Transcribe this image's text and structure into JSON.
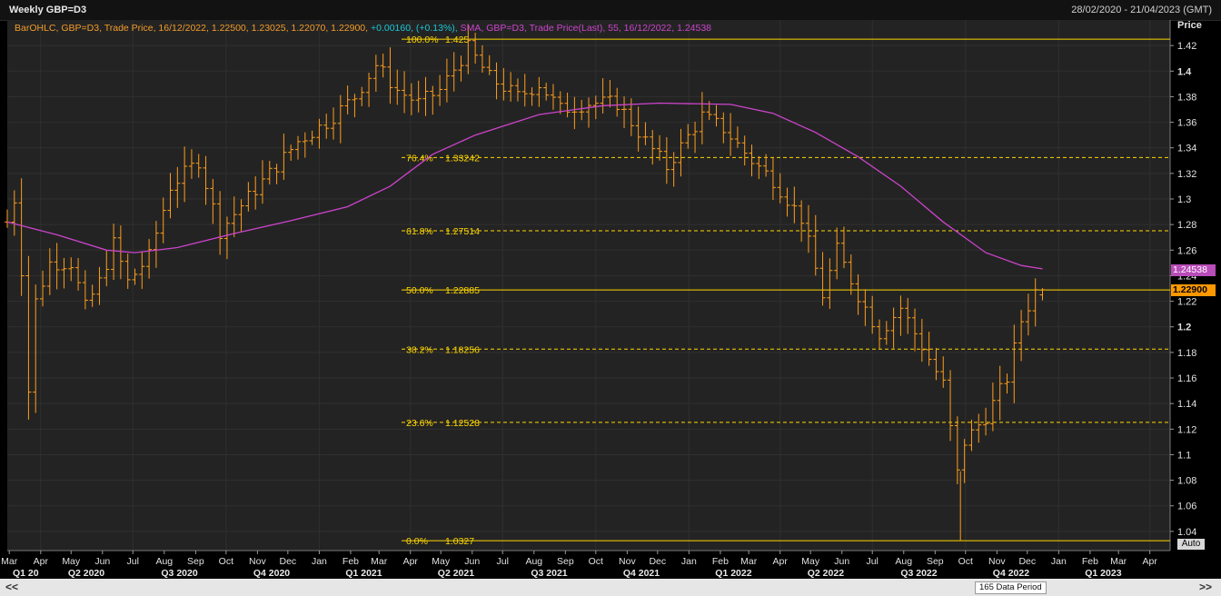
{
  "header": {
    "title": "Weekly GBP=D3",
    "date_range": "28/02/2020 - 21/04/2023 (GMT)"
  },
  "info_line": {
    "ohlc_prefix": "BarOHLC, GBP=D3, Trade Price, 16/12/2022, 1.22500, 1.23025, 1.22070, 1.22900,",
    "change": "+0.00160, (+0.13%),",
    "sma": "SMA, GBP=D3, Trade Price(Last), 55, 16/12/2022, 1.24538"
  },
  "price_axis": {
    "title": "Price",
    "sma_tag": "1.24538",
    "last_tag": "1.22900",
    "auto_button": "Auto"
  },
  "footer": {
    "data_period": "165 Data Period",
    "nav_left": "<<",
    "nav_right": ">>"
  },
  "colors": {
    "ohlc": "#ff9e1b",
    "sma": "#cc44cc",
    "fib": "#ffd700",
    "background": "#232323"
  },
  "chart_data": {
    "type": "line",
    "series_types": {
      "GBP=D3": "ohlc_bar",
      "SMA 55": "line"
    },
    "ylim": [
      1.025,
      1.44
    ],
    "y_ticks": [
      1.04,
      1.06,
      1.08,
      1.1,
      1.12,
      1.14,
      1.16,
      1.18,
      1.2,
      1.22,
      1.24,
      1.26,
      1.28,
      1.3,
      1.32,
      1.34,
      1.36,
      1.38,
      1.4,
      1.42
    ],
    "x_range": [
      "2020-02-28",
      "2023-04-21"
    ],
    "month_ticks": [
      {
        "label": "Mar",
        "date": "2020-03-01"
      },
      {
        "label": "Apr",
        "date": "2020-04-01"
      },
      {
        "label": "May",
        "date": "2020-05-01"
      },
      {
        "label": "Jun",
        "date": "2020-06-01"
      },
      {
        "label": "Jul",
        "date": "2020-07-01"
      },
      {
        "label": "Aug",
        "date": "2020-08-01"
      },
      {
        "label": "Sep",
        "date": "2020-09-01"
      },
      {
        "label": "Oct",
        "date": "2020-10-01"
      },
      {
        "label": "Nov",
        "date": "2020-11-01"
      },
      {
        "label": "Dec",
        "date": "2020-12-01"
      },
      {
        "label": "Jan",
        "date": "2021-01-01"
      },
      {
        "label": "Feb",
        "date": "2021-02-01"
      },
      {
        "label": "Mar",
        "date": "2021-03-01"
      },
      {
        "label": "Apr",
        "date": "2021-04-01"
      },
      {
        "label": "May",
        "date": "2021-05-01"
      },
      {
        "label": "Jun",
        "date": "2021-06-01"
      },
      {
        "label": "Jul",
        "date": "2021-07-01"
      },
      {
        "label": "Aug",
        "date": "2021-08-01"
      },
      {
        "label": "Sep",
        "date": "2021-09-01"
      },
      {
        "label": "Oct",
        "date": "2021-10-01"
      },
      {
        "label": "Nov",
        "date": "2021-11-01"
      },
      {
        "label": "Dec",
        "date": "2021-12-01"
      },
      {
        "label": "Jan",
        "date": "2022-01-01"
      },
      {
        "label": "Feb",
        "date": "2022-02-01"
      },
      {
        "label": "Mar",
        "date": "2022-03-01"
      },
      {
        "label": "Apr",
        "date": "2022-04-01"
      },
      {
        "label": "May",
        "date": "2022-05-01"
      },
      {
        "label": "Jun",
        "date": "2022-06-01"
      },
      {
        "label": "Jul",
        "date": "2022-07-01"
      },
      {
        "label": "Aug",
        "date": "2022-08-01"
      },
      {
        "label": "Sep",
        "date": "2022-09-01"
      },
      {
        "label": "Oct",
        "date": "2022-10-01"
      },
      {
        "label": "Nov",
        "date": "2022-11-01"
      },
      {
        "label": "Dec",
        "date": "2022-12-01"
      },
      {
        "label": "Jan",
        "date": "2023-01-01"
      },
      {
        "label": "Feb",
        "date": "2023-02-01"
      },
      {
        "label": "Mar",
        "date": "2023-03-01"
      },
      {
        "label": "Apr",
        "date": "2023-04-01"
      }
    ],
    "quarter_ticks": [
      {
        "label": "Q1 20",
        "date": "2020-02-28"
      },
      {
        "label": "Q2 2020",
        "date": "2020-05-16"
      },
      {
        "label": "Q3 2020",
        "date": "2020-08-16"
      },
      {
        "label": "Q4 2020",
        "date": "2020-11-15"
      },
      {
        "label": "Q1 2021",
        "date": "2021-02-14"
      },
      {
        "label": "Q2 2021",
        "date": "2021-05-16"
      },
      {
        "label": "Q3 2021",
        "date": "2021-08-16"
      },
      {
        "label": "Q4 2021",
        "date": "2021-11-15"
      },
      {
        "label": "Q1 2022",
        "date": "2022-02-14"
      },
      {
        "label": "Q2 2022",
        "date": "2022-05-16"
      },
      {
        "label": "Q3 2022",
        "date": "2022-08-16"
      },
      {
        "label": "Q4 2022",
        "date": "2022-11-15"
      },
      {
        "label": "Q1 2023",
        "date": "2023-02-14"
      }
    ],
    "fib_levels": [
      {
        "pct": "100.0%",
        "value": 1.425,
        "label": "1.425",
        "style": "solid"
      },
      {
        "pct": "76.4%",
        "value": 1.33242,
        "label": "1.33242",
        "style": "dashed"
      },
      {
        "pct": "61.8%",
        "value": 1.27514,
        "label": "1.27514",
        "style": "dashed"
      },
      {
        "pct": "50.0%",
        "value": 1.22885,
        "label": "1.22885",
        "style": "solid"
      },
      {
        "pct": "38.2%",
        "value": 1.18256,
        "label": "1.18256",
        "style": "dashed"
      },
      {
        "pct": "23.6%",
        "value": 1.12528,
        "label": "1.12528",
        "style": "dashed"
      },
      {
        "pct": "0.0%",
        "value": 1.0327,
        "label": "1.0327",
        "style": "solid"
      }
    ],
    "anchors": [
      [
        "2020-02-28",
        1.282
      ],
      [
        "2020-03-06",
        1.3
      ],
      [
        "2020-03-13",
        1.245
      ],
      [
        "2020-03-20",
        1.15
      ],
      [
        "2020-03-27",
        1.22
      ],
      [
        "2020-04-10",
        1.25
      ],
      [
        "2020-05-01",
        1.25
      ],
      [
        "2020-05-15",
        1.215
      ],
      [
        "2020-05-29",
        1.235
      ],
      [
        "2020-06-12",
        1.265
      ],
      [
        "2020-06-26",
        1.235
      ],
      [
        "2020-07-17",
        1.255
      ],
      [
        "2020-08-07",
        1.31
      ],
      [
        "2020-09-04",
        1.33
      ],
      [
        "2020-09-25",
        1.275
      ],
      [
        "2020-10-16",
        1.295
      ],
      [
        "2020-11-13",
        1.32
      ],
      [
        "2020-12-11",
        1.345
      ],
      [
        "2021-01-08",
        1.36
      ],
      [
        "2021-02-05",
        1.38
      ],
      [
        "2021-02-26",
        1.405
      ],
      [
        "2021-03-19",
        1.385
      ],
      [
        "2021-04-09",
        1.375
      ],
      [
        "2021-04-30",
        1.385
      ],
      [
        "2021-05-28",
        1.418
      ],
      [
        "2021-06-18",
        1.395
      ],
      [
        "2021-07-16",
        1.38
      ],
      [
        "2021-08-06",
        1.39
      ],
      [
        "2021-08-27",
        1.37
      ],
      [
        "2021-09-24",
        1.375
      ],
      [
        "2021-10-22",
        1.375
      ],
      [
        "2021-11-19",
        1.345
      ],
      [
        "2021-12-10",
        1.325
      ],
      [
        "2022-01-14",
        1.365
      ],
      [
        "2022-02-04",
        1.355
      ],
      [
        "2022-03-04",
        1.33
      ],
      [
        "2022-03-25",
        1.315
      ],
      [
        "2022-04-22",
        1.285
      ],
      [
        "2022-05-13",
        1.225
      ],
      [
        "2022-05-27",
        1.26
      ],
      [
        "2022-06-17",
        1.225
      ],
      [
        "2022-07-08",
        1.195
      ],
      [
        "2022-07-29",
        1.215
      ],
      [
        "2022-08-19",
        1.185
      ],
      [
        "2022-09-09",
        1.155
      ],
      [
        "2022-09-23",
        1.085
      ],
      [
        "2022-09-30",
        1.11
      ],
      [
        "2022-10-21",
        1.13
      ],
      [
        "2022-11-11",
        1.16
      ],
      [
        "2022-11-25",
        1.205
      ],
      [
        "2022-12-09",
        1.228
      ],
      [
        "2022-12-16",
        1.229
      ]
    ],
    "sma": {
      "name": "SMA 55",
      "points": [
        [
          "2020-02-28",
          1.282
        ],
        [
          "2020-04-17",
          1.272
        ],
        [
          "2020-06-05",
          1.26
        ],
        [
          "2020-07-03",
          1.258
        ],
        [
          "2020-08-14",
          1.262
        ],
        [
          "2020-10-09",
          1.273
        ],
        [
          "2020-12-04",
          1.283
        ],
        [
          "2021-01-29",
          1.294
        ],
        [
          "2021-03-12",
          1.31
        ],
        [
          "2021-04-23",
          1.335
        ],
        [
          "2021-06-04",
          1.35
        ],
        [
          "2021-08-06",
          1.366
        ],
        [
          "2021-10-08",
          1.373
        ],
        [
          "2021-12-03",
          1.375
        ],
        [
          "2022-02-11",
          1.374
        ],
        [
          "2022-03-25",
          1.367
        ],
        [
          "2022-05-06",
          1.352
        ],
        [
          "2022-06-17",
          1.333
        ],
        [
          "2022-07-29",
          1.31
        ],
        [
          "2022-09-09",
          1.282
        ],
        [
          "2022-10-21",
          1.258
        ],
        [
          "2022-11-25",
          1.248
        ],
        [
          "2022-12-16",
          1.24538
        ]
      ]
    },
    "last_bar": {
      "date": "2022-12-16",
      "open": 1.225,
      "high": 1.23025,
      "low": 1.2207,
      "close": 1.229
    }
  }
}
